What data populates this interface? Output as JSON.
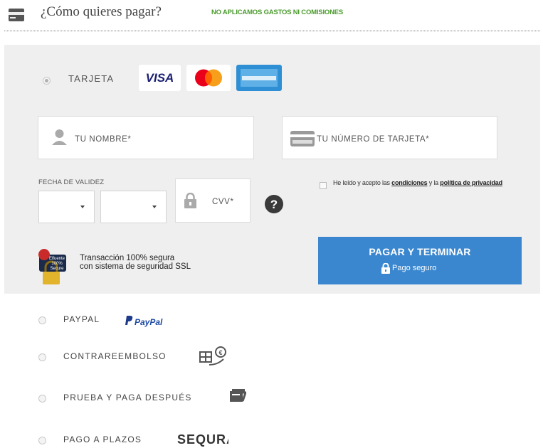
{
  "header": {
    "title": "¿Cómo quieres pagar?",
    "tagline": "NO APLICAMOS GASTOS NI COMISIONES",
    "icon": "wallet-icon"
  },
  "card": {
    "label": "TARJETA",
    "brands": [
      "VISA",
      "MasterCard",
      "AMERICAN EXPRESS"
    ],
    "name_placeholder": "TU NOMBRE*",
    "number_placeholder": "TU NÚMERO DE TARJETA*",
    "expiry_label": "FECHA DE VALIDEZ",
    "cvv_placeholder": "CVV*",
    "help_icon": "question-icon",
    "terms": {
      "prefix": "He leído y acepto las ",
      "conditions": "condiciones",
      "middle": " y la ",
      "privacy": "política de privacidad"
    },
    "pay_button": "PAGAR Y TERMINAR",
    "pay_button_sub": "Pago seguro",
    "ssl_line1": "Transacción 100% segura",
    "ssl_line2": "con sistema de seguridad SSL",
    "ssl_badge": [
      "Elfuente",
      "100%",
      "Secure"
    ],
    "accent_color": "#3a87cf"
  },
  "options": [
    {
      "label": "PAYPAL",
      "logo": "PayPal"
    },
    {
      "label": "CONTRAREEMBOLSO",
      "logo": "cash-on-delivery-icon"
    },
    {
      "label": "PRUEBA Y PAGA DESPUÉS",
      "logo": "try-and-pay-icon"
    },
    {
      "label": "PAGO A PLAZOS",
      "logo": "SEQURA"
    }
  ]
}
